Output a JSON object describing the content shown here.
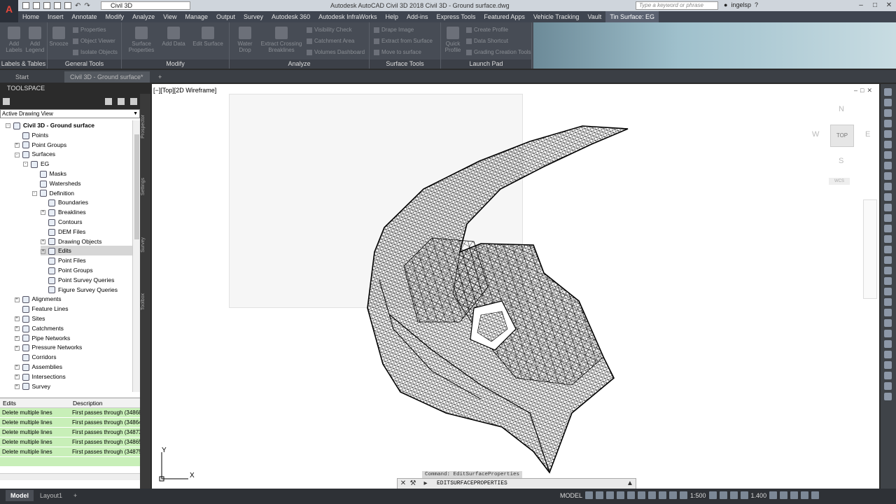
{
  "titlebar": {
    "workspace": "Civil 3D",
    "app_title": "Autodesk AutoCAD Civil 3D 2018   Civil 3D - Ground surface.dwg",
    "search_placeholder": "Type a keyword or phrase",
    "user": "ingelsp",
    "logo_label": "A"
  },
  "ribbon_tabs": [
    "Home",
    "Insert",
    "Annotate",
    "Modify",
    "Analyze",
    "View",
    "Manage",
    "Output",
    "Survey",
    "Autodesk 360",
    "Autodesk InfraWorks",
    "Help",
    "Add-ins",
    "Express Tools",
    "Featured Apps",
    "Vehicle Tracking",
    "Vault",
    "Tin Surface: EG"
  ],
  "ribbon": {
    "panels": [
      {
        "title": "Labels & Tables",
        "buttons": [
          "Add Labels",
          "Add Legend"
        ]
      },
      {
        "title": "General Tools",
        "buttons": [
          "Snooze"
        ],
        "small": [
          "Properties",
          "Object Viewer",
          "Isolate Objects"
        ]
      },
      {
        "title": "Modify",
        "buttons": [
          "Surface Properties",
          "Add Data",
          "Edit Surface"
        ]
      },
      {
        "title": "Analyze",
        "buttons": [
          "Water Drop",
          "Extract Crossing Breaklines"
        ],
        "small": [
          "Visibility Check",
          "Catchment Area",
          "Volumes Dashboard"
        ]
      },
      {
        "title": "Surface Tools",
        "small": [
          "Drape Image",
          "Extract from Surface",
          "Move to surface"
        ]
      },
      {
        "title": "Launch Pad",
        "buttons": [
          "Quick Profile"
        ],
        "small": [
          "Create Profile",
          "Data Shortcut",
          "Grading Creation Tools"
        ]
      }
    ]
  },
  "doc_tabs": {
    "start": "Start",
    "active": "Civil 3D - Ground surface*",
    "plus": "+"
  },
  "toolspace": {
    "title": "TOOLSPACE",
    "view_selector": "Active Drawing View",
    "side_tabs": [
      "Prospector",
      "Settings",
      "Survey",
      "Toolbox"
    ],
    "tree": [
      {
        "label": "Civil 3D - Ground surface",
        "indent": 0,
        "exp": "-",
        "bold": true
      },
      {
        "label": "Points",
        "indent": 1,
        "exp": ""
      },
      {
        "label": "Point Groups",
        "indent": 1,
        "exp": "+"
      },
      {
        "label": "Surfaces",
        "indent": 1,
        "exp": "-"
      },
      {
        "label": "EG",
        "indent": 2,
        "exp": "-"
      },
      {
        "label": "Masks",
        "indent": 3,
        "exp": ""
      },
      {
        "label": "Watersheds",
        "indent": 3,
        "exp": ""
      },
      {
        "label": "Definition",
        "indent": 3,
        "exp": "-"
      },
      {
        "label": "Boundaries",
        "indent": 4,
        "exp": ""
      },
      {
        "label": "Breaklines",
        "indent": 4,
        "exp": "+"
      },
      {
        "label": "Contours",
        "indent": 4,
        "exp": ""
      },
      {
        "label": "DEM Files",
        "indent": 4,
        "exp": ""
      },
      {
        "label": "Drawing Objects",
        "indent": 4,
        "exp": "+"
      },
      {
        "label": "Edits",
        "indent": 4,
        "exp": "+",
        "selected": true
      },
      {
        "label": "Point Files",
        "indent": 4,
        "exp": ""
      },
      {
        "label": "Point Groups",
        "indent": 4,
        "exp": ""
      },
      {
        "label": "Point Survey Queries",
        "indent": 4,
        "exp": ""
      },
      {
        "label": "Figure Survey Queries",
        "indent": 4,
        "exp": ""
      },
      {
        "label": "Alignments",
        "indent": 1,
        "exp": "+"
      },
      {
        "label": "Feature Lines",
        "indent": 1,
        "exp": ""
      },
      {
        "label": "Sites",
        "indent": 1,
        "exp": "+"
      },
      {
        "label": "Catchments",
        "indent": 1,
        "exp": "+"
      },
      {
        "label": "Pipe Networks",
        "indent": 1,
        "exp": "+"
      },
      {
        "label": "Pressure Networks",
        "indent": 1,
        "exp": "+"
      },
      {
        "label": "Corridors",
        "indent": 1,
        "exp": ""
      },
      {
        "label": "Assemblies",
        "indent": 1,
        "exp": "+"
      },
      {
        "label": "Intersections",
        "indent": 1,
        "exp": "+"
      },
      {
        "label": "Survey",
        "indent": 1,
        "exp": "+"
      }
    ],
    "edits_table": {
      "headers": [
        "Edits",
        "Description"
      ],
      "rows": [
        [
          "Delete multiple lines",
          "First passes through (34868"
        ],
        [
          "Delete multiple lines",
          "First passes through (34864"
        ],
        [
          "Delete multiple lines",
          "First passes through (34873"
        ],
        [
          "Delete multiple lines",
          "First passes through (34865"
        ],
        [
          "Delete multiple lines",
          "First passes through (34875"
        ]
      ]
    }
  },
  "viewport": {
    "label": "[−][Top][2D Wireframe]",
    "viewcube": {
      "n": "N",
      "s": "S",
      "e": "E",
      "w": "W",
      "top": "TOP",
      "wcs": "WCS"
    },
    "ucs_x": "X",
    "ucs_y": "Y"
  },
  "command": {
    "history": "Command: EditSurfaceProperties",
    "current": "EDITSURFACEPROPERTIES"
  },
  "statusbar": {
    "tabs": [
      "Model",
      "Layout1",
      "+"
    ],
    "model": "MODEL",
    "scale": "1:500",
    "annotation_scale": "1.400"
  }
}
